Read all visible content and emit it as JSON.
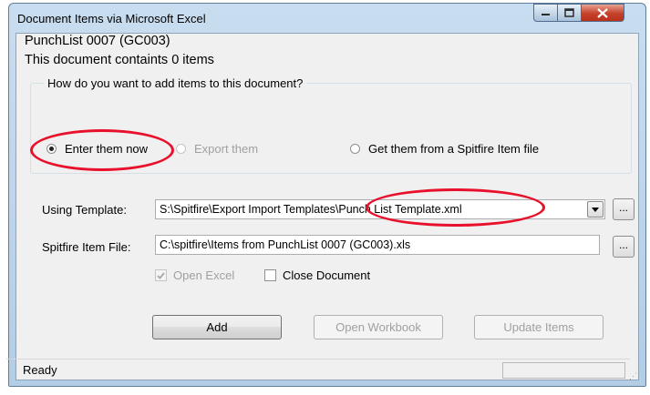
{
  "window": {
    "title": "Document Items via Microsoft Excel",
    "controls": {
      "minimize_icon": "minimize-icon",
      "maximize_icon": "maximize-icon",
      "close_icon": "close-icon"
    }
  },
  "document": {
    "name": "PunchList 0007 (GC003)",
    "item_count_text": "This document containts 0 items"
  },
  "add_items_group": {
    "legend": "How do you want to add items to this document?",
    "options": [
      {
        "label": "Enter them now",
        "selected": true,
        "enabled": true
      },
      {
        "label": "Export them",
        "selected": false,
        "enabled": false
      },
      {
        "label": "Get them from a Spitfire Item file",
        "selected": false,
        "enabled": true
      }
    ]
  },
  "template": {
    "label": "Using Template:",
    "value": "S:\\Spitfire\\Export Import Templates\\Punch List Template.xml",
    "browse_label": "..."
  },
  "item_file": {
    "label": "Spitfire Item File:",
    "value": "C:\\spitfire\\Items from PunchList 0007 (GC003).xls",
    "browse_label": "..."
  },
  "options": {
    "open_excel": {
      "label": "Open Excel",
      "checked": true,
      "enabled": false
    },
    "close_document": {
      "label": "Close Document",
      "checked": false,
      "enabled": true
    }
  },
  "buttons": {
    "add": "Add",
    "open_workbook": "Open Workbook",
    "update_items": "Update Items"
  },
  "status": {
    "text": "Ready"
  },
  "colors": {
    "highlight": "#e8102b",
    "disabled_text": "#a0a0a0",
    "close_button": "#c4412a"
  }
}
